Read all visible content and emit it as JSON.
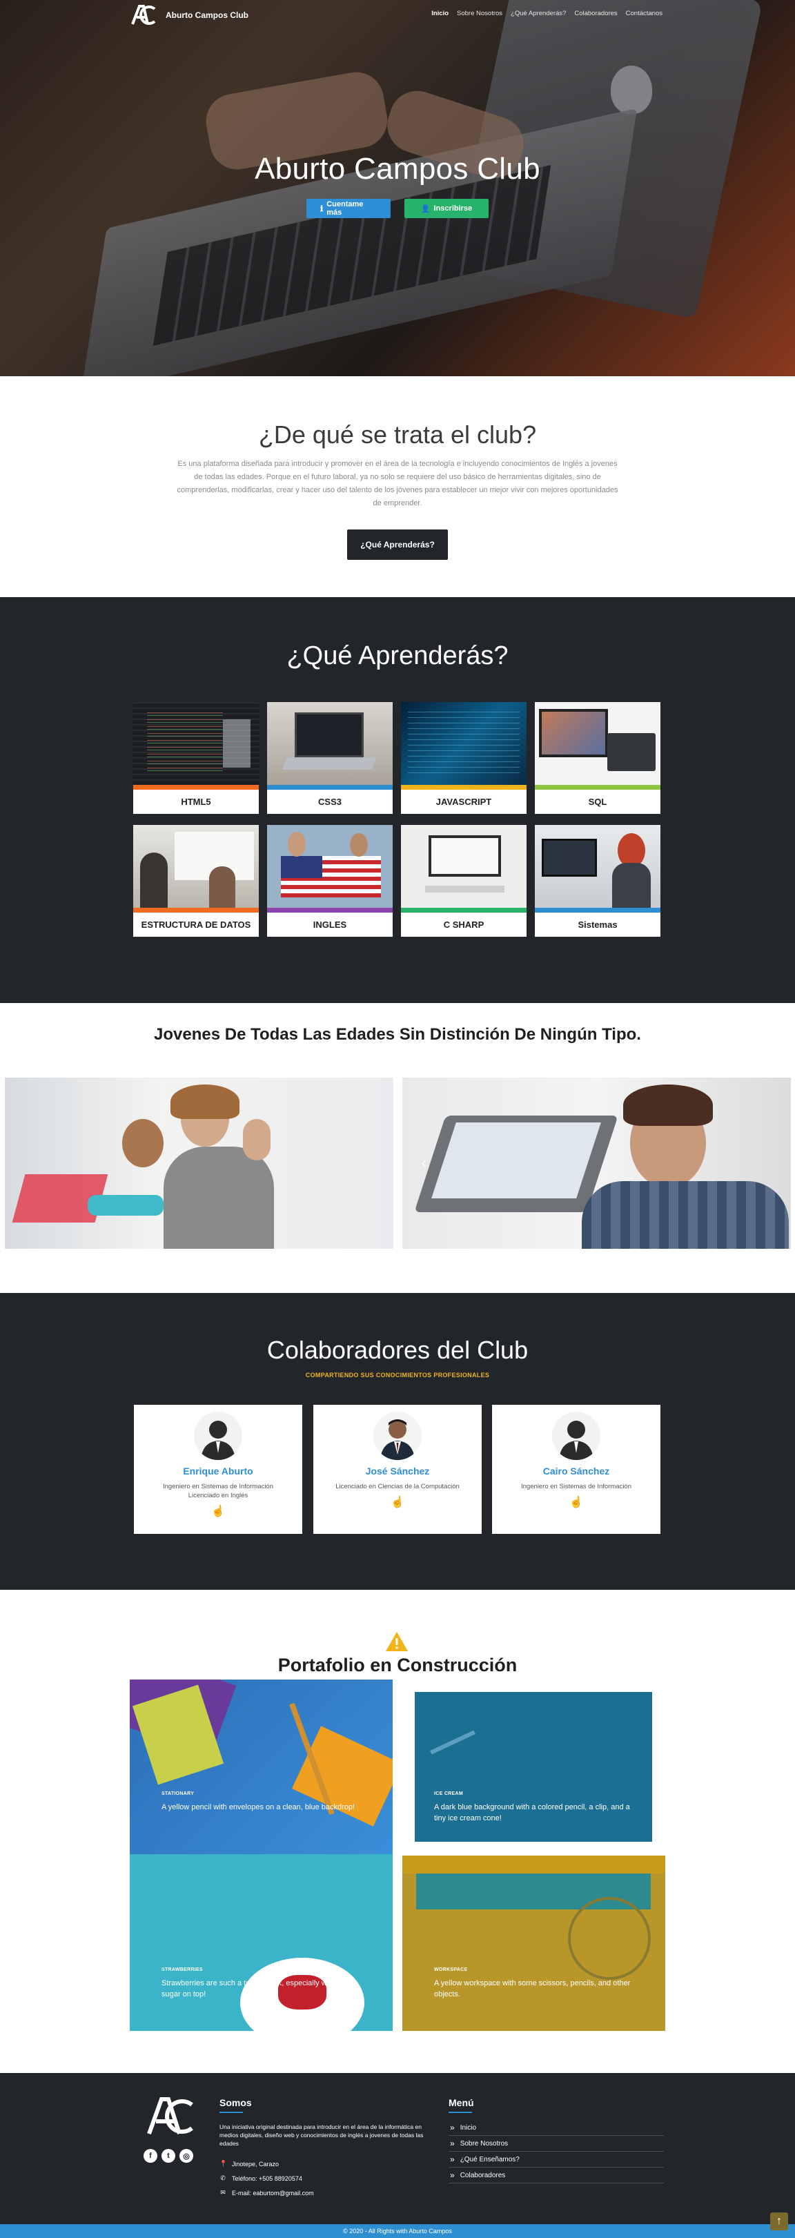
{
  "nav": {
    "brand": "Aburto Campos Club",
    "items": [
      {
        "label": "Inicio",
        "active": true
      },
      {
        "label": "Sobre Nosotros",
        "active": false
      },
      {
        "label": "¿Qué Aprenderás?",
        "active": false
      },
      {
        "label": "Colaboradores",
        "active": false
      },
      {
        "label": "Contáctanos",
        "active": false
      }
    ]
  },
  "hero": {
    "title": "Aburto Campos Club",
    "btn_more": "Cuentame más",
    "btn_register": "Inscribirse"
  },
  "about": {
    "title": "¿De qué se trata el club?",
    "text": "Es una plataforma diseñada para introducir y promover en el área de la tecnología e incluyendo conocimientos de Inglés a jovenes de todas las edades. Porque en el futuro laboral, ya no solo se requiere del uso básico de herramientas digitales, sino de comprenderlas, modificarlas, crear y hacer uso del talento de los jóvenes para establecer un mejor vivir con mejores oportunidades de emprender.",
    "button": "¿Qué Aprenderás?"
  },
  "learn": {
    "title": "¿Qué Aprenderás?",
    "courses": [
      {
        "label": "HTML5",
        "color": "#f26b21"
      },
      {
        "label": "CSS3",
        "color": "#2e8fd0"
      },
      {
        "label": "JAVASCRIPT",
        "color": "#f0b31a"
      },
      {
        "label": "SQL",
        "color": "#8cc63f"
      },
      {
        "label": "ESTRUCTURA DE DATOS",
        "color": "#f26b21"
      },
      {
        "label": "INGLES",
        "color": "#8e44ad"
      },
      {
        "label": "C SHARP",
        "color": "#27b36a"
      },
      {
        "label": "Sistemas",
        "color": "#2e8fd0"
      }
    ]
  },
  "youth": {
    "title": "Jovenes De Todas Las Edades Sin Distinción De Ningún Tipo."
  },
  "collab": {
    "title": "Colaboradores del Club",
    "subtitle": "COMPARTIENDO SUS CONOCIMIENTOS PROFESIONALES",
    "people": [
      {
        "name": "Enrique Aburto",
        "desc": "Ingeniero en Sistemas de Información Licenciado en Inglés"
      },
      {
        "name": "José Sánchez",
        "desc": "Licenciado en Ciencias de la Computación"
      },
      {
        "name": "Cairo Sánchez",
        "desc": "Ingeniero en Sistemas de Información"
      }
    ]
  },
  "portfolio": {
    "title": "Portafolio en Construcción",
    "tiles": [
      {
        "tag": "STATIONARY",
        "caption": "A yellow pencil with envelopes on a clean, blue backdrop!"
      },
      {
        "tag": "ICE CREAM",
        "caption": "A dark blue background with a colored pencil, a clip, and a tiny ice cream cone!"
      },
      {
        "tag": "STRAWBERRIES",
        "caption": "Strawberries are such a tasty snack, especially with a little sugar on top!"
      },
      {
        "tag": "WORKSPACE",
        "caption": "A yellow workspace with some scissors, pencils, and other objects."
      }
    ]
  },
  "footer": {
    "about_title": "Somos",
    "about_text": "Una iniciativa original destinada para introducir en el área de la informática en medios digitales, diseño web y conocimientos de inglés a jovenes de todas las edades",
    "location": "Jinotepe, Carazo",
    "phone": "Teléfono: +505 88920574",
    "email": "E-mail: eaburtom@gmail.com",
    "menu_title": "Menú",
    "menu": [
      "Inicio",
      "Sobre Nosotros",
      "¿Qué Enseñamos?",
      "Colaboradores"
    ],
    "copyright": "© 2020 - All Rights with Aburto Campos"
  }
}
